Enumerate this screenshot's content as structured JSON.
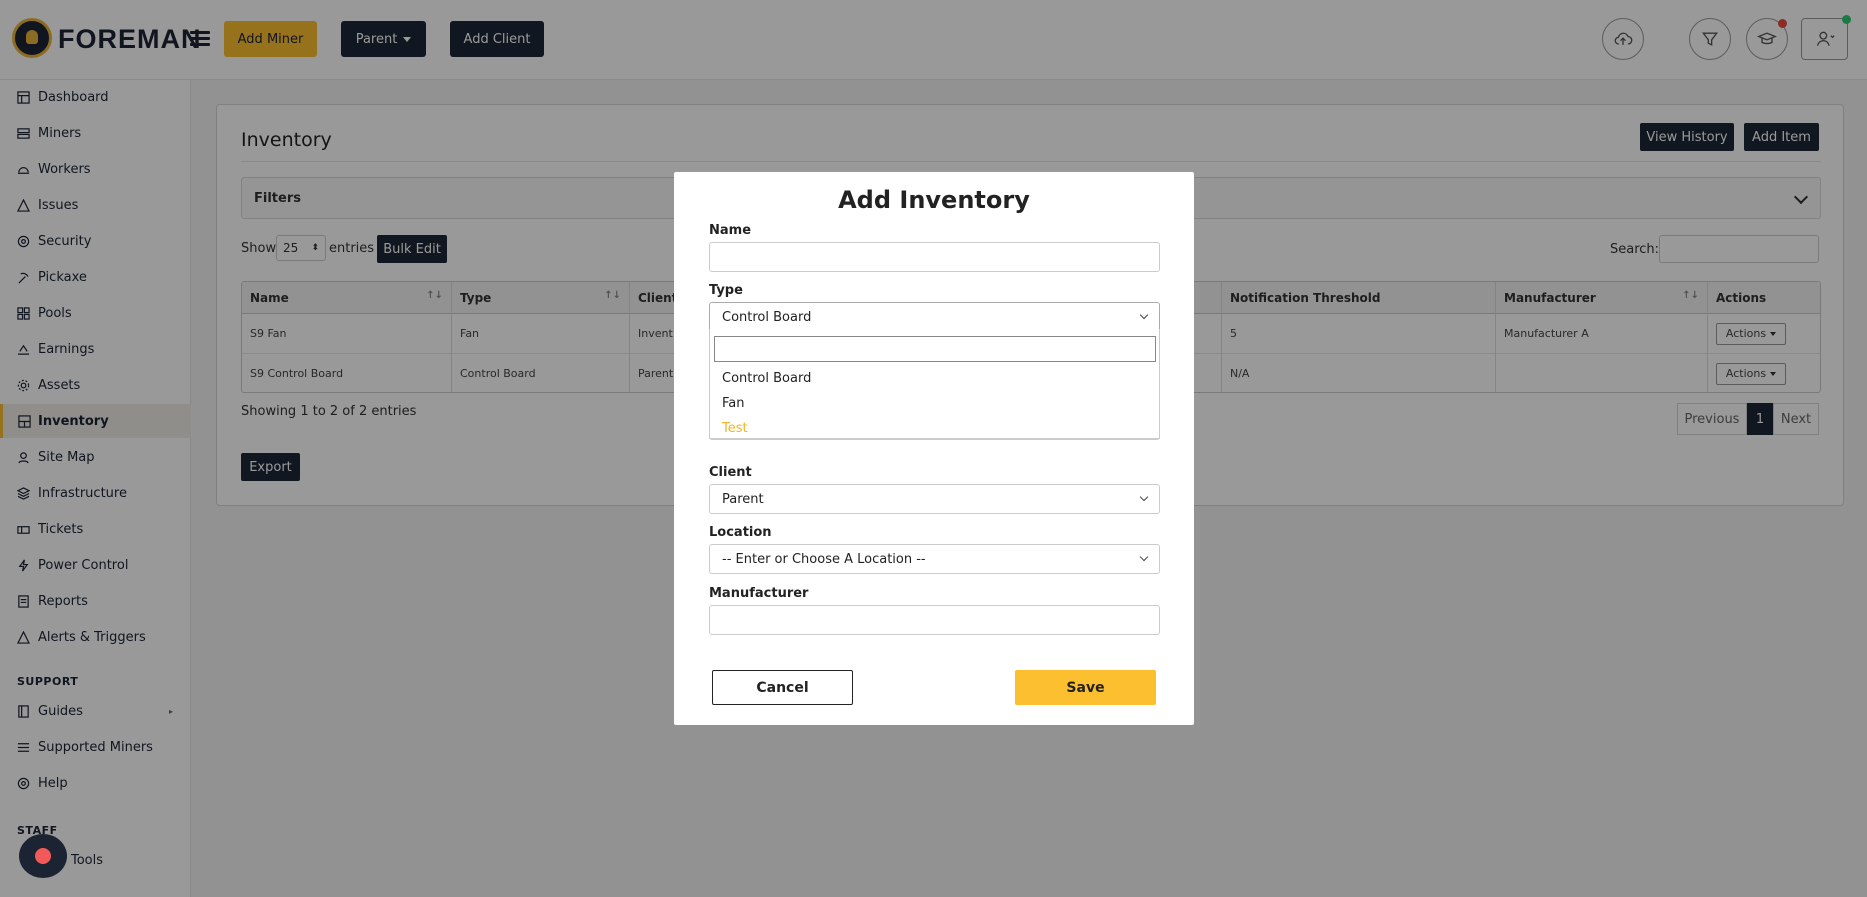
{
  "header": {
    "brand": "FOREMAN",
    "add_miner": "Add Miner",
    "parent": "Parent",
    "add_client": "Add Client"
  },
  "sidebar": {
    "items": [
      {
        "label": "Dashboard",
        "icon": "dashboard-icon"
      },
      {
        "label": "Miners",
        "icon": "server-icon"
      },
      {
        "label": "Workers",
        "icon": "hard-hat-icon"
      },
      {
        "label": "Issues",
        "icon": "warning-icon"
      },
      {
        "label": "Security",
        "icon": "shield-icon"
      },
      {
        "label": "Pickaxe",
        "icon": "pickaxe-icon"
      },
      {
        "label": "Pools",
        "icon": "pools-icon"
      },
      {
        "label": "Earnings",
        "icon": "coins-icon"
      },
      {
        "label": "Assets",
        "icon": "gear-icon"
      },
      {
        "label": "Inventory",
        "icon": "inventory-icon"
      },
      {
        "label": "Site Map",
        "icon": "map-pin-icon"
      },
      {
        "label": "Infrastructure",
        "icon": "layers-icon"
      },
      {
        "label": "Tickets",
        "icon": "ticket-icon"
      },
      {
        "label": "Power Control",
        "icon": "bolt-icon"
      },
      {
        "label": "Reports",
        "icon": "report-icon"
      },
      {
        "label": "Alerts & Triggers",
        "icon": "bell-icon"
      }
    ],
    "support_heading": "SUPPORT",
    "support_items": [
      {
        "label": "Guides",
        "icon": "book-icon"
      },
      {
        "label": "Supported Miners",
        "icon": "list-icon"
      },
      {
        "label": "Help",
        "icon": "help-icon"
      }
    ],
    "staff_heading": "STAFF",
    "staff_tools": "Tools"
  },
  "inventory": {
    "title": "Inventory",
    "view_history": "View History",
    "add_item": "Add Item",
    "filters": "Filters",
    "show": "Show",
    "page_size": "25",
    "entries": "entries",
    "bulk_edit": "Bulk Edit",
    "search_label": "Search:",
    "columns": [
      "Name",
      "Type",
      "Client",
      "Notification Threshold",
      "Manufacturer",
      "Actions"
    ],
    "rows": [
      {
        "name": "S9 Fan",
        "type": "Fan",
        "client": "Invent",
        "threshold": "5",
        "manufacturer": "Manufacturer A",
        "actions": "Actions"
      },
      {
        "name": "S9 Control Board",
        "type": "Control Board",
        "client": "Parent",
        "threshold": "N/A",
        "manufacturer": "",
        "actions": "Actions"
      }
    ],
    "showing": "Showing 1 to 2 of 2 entries",
    "prev": "Previous",
    "page": "1",
    "next": "Next",
    "export": "Export"
  },
  "modal": {
    "title": "Add Inventory",
    "name_label": "Name",
    "name_value": "",
    "type_label": "Type",
    "type_value": "Control Board",
    "type_options": [
      "Control Board",
      "Fan",
      "Test"
    ],
    "client_label": "Client",
    "client_value": "Parent",
    "location_label": "Location",
    "location_value": "-- Enter or Choose A Location --",
    "manufacturer_label": "Manufacturer",
    "manufacturer_value": "",
    "cancel": "Cancel",
    "save": "Save"
  },
  "colors": {
    "accent": "#fbbf2f",
    "navy": "#1c2738",
    "highlight": "#f0b429"
  }
}
